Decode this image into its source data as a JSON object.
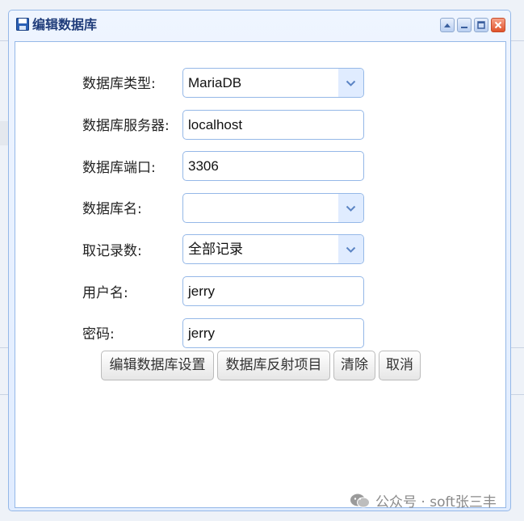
{
  "window": {
    "title": "编辑数据库"
  },
  "form": {
    "db_type": {
      "label": "数据库类型:",
      "value": "MariaDB"
    },
    "db_server": {
      "label": "数据库服务器:",
      "value": "localhost"
    },
    "db_port": {
      "label": "数据库端口:",
      "value": "3306"
    },
    "db_name": {
      "label": "数据库名:",
      "value": ""
    },
    "record_count": {
      "label": "取记录数:",
      "value": "全部记录"
    },
    "username": {
      "label": "用户名:",
      "value": "jerry"
    },
    "password": {
      "label": "密码:",
      "value": "jerry"
    }
  },
  "buttons": {
    "edit_settings": "编辑数据库设置",
    "reflect_project": "数据库反射项目",
    "clear": "清除",
    "cancel": "取消"
  },
  "watermark": {
    "text": "公众号 · soft张三丰"
  },
  "colors": {
    "accent": "#95b8e7",
    "title": "#1f3c7a",
    "close": "#e0532b"
  }
}
